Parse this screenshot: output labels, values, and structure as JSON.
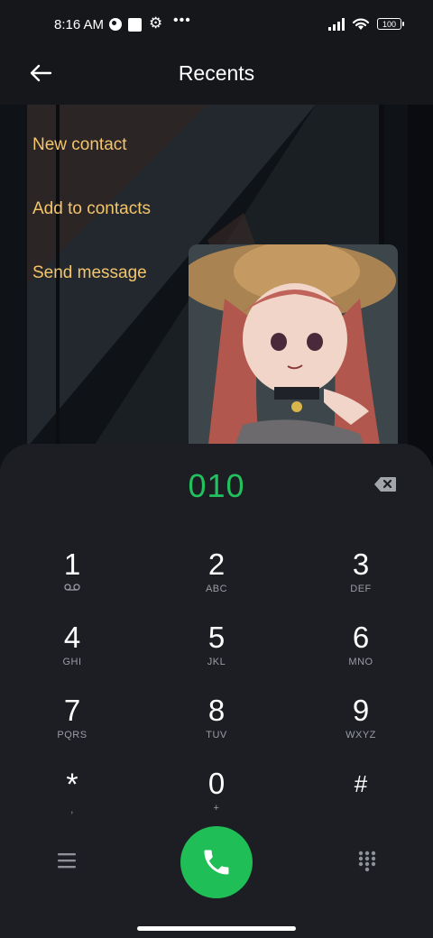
{
  "status_bar": {
    "time": "8:16 AM",
    "battery": "100",
    "icons": [
      "notification-circle-icon",
      "square-icon",
      "gear-icon",
      "more-dots-icon",
      "signal-icon",
      "wifi-icon",
      "battery-icon"
    ]
  },
  "header": {
    "title": "Recents",
    "back_icon": "back-arrow-icon"
  },
  "actions": {
    "new_contact": "New contact",
    "add_to_contacts": "Add to contacts",
    "send_message": "Send message"
  },
  "dialer": {
    "number": "010",
    "keys": [
      {
        "digit": "1",
        "letters": ""
      },
      {
        "digit": "2",
        "letters": "ABC"
      },
      {
        "digit": "3",
        "letters": "DEF"
      },
      {
        "digit": "4",
        "letters": "GHI"
      },
      {
        "digit": "5",
        "letters": "JKL"
      },
      {
        "digit": "6",
        "letters": "MNO"
      },
      {
        "digit": "7",
        "letters": "PQRS"
      },
      {
        "digit": "8",
        "letters": "TUV"
      },
      {
        "digit": "9",
        "letters": "WXYZ"
      },
      {
        "digit": "*",
        "letters": ","
      },
      {
        "digit": "0",
        "letters": "+"
      },
      {
        "digit": "#",
        "letters": ""
      }
    ]
  },
  "colors": {
    "accent_green": "#1fbe57",
    "action_text": "#f4c56b",
    "dialer_bg": "#1c1e23",
    "screen_bg": "#15171b"
  }
}
